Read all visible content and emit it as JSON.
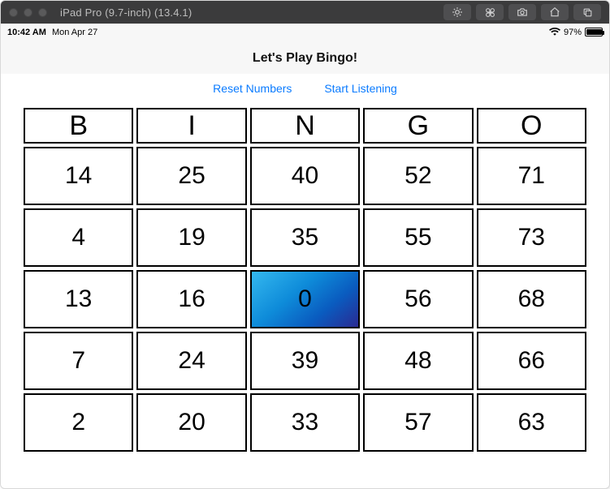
{
  "window": {
    "title": "iPad Pro (9.7-inch) (13.4.1)"
  },
  "status": {
    "time": "10:42 AM",
    "date": "Mon Apr 27",
    "battery_pct": "97%"
  },
  "header": {
    "title": "Let's Play Bingo!"
  },
  "links": {
    "reset": "Reset Numbers",
    "listen": "Start Listening"
  },
  "bingo": {
    "headers": [
      "B",
      "I",
      "N",
      "G",
      "O"
    ],
    "rows": [
      [
        "14",
        "25",
        "40",
        "52",
        "71"
      ],
      [
        "4",
        "19",
        "35",
        "55",
        "73"
      ],
      [
        "13",
        "16",
        "0",
        "56",
        "68"
      ],
      [
        "7",
        "24",
        "39",
        "48",
        "66"
      ],
      [
        "2",
        "20",
        "33",
        "57",
        "63"
      ]
    ]
  }
}
